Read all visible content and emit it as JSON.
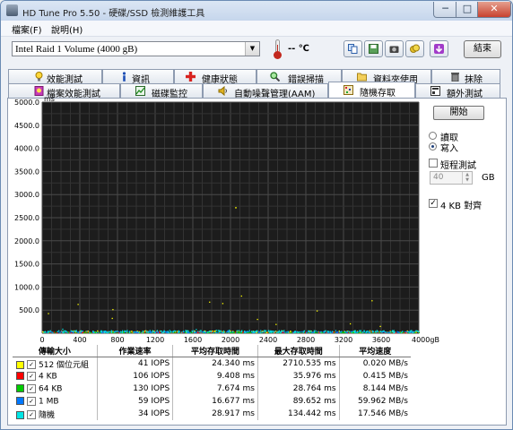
{
  "window": {
    "title": "HD Tune Pro 5.50 - 硬碟/SSD 檢測維護工具",
    "minimize": "─",
    "maximize": "□",
    "close": "✕"
  },
  "menu": {
    "file": "檔案(F)",
    "help": "說明(H)"
  },
  "toolbar": {
    "drive": "Intel  Raid 1 Volume (4000 gB)",
    "temperature": "-- ℃",
    "exit_label": "結束",
    "icons": [
      "copy-icon",
      "save-icon",
      "camera-icon",
      "coin-icon",
      "download-icon"
    ]
  },
  "tabs_row1": [
    {
      "label": "效能測試",
      "icon": "bulb-icon"
    },
    {
      "label": "資訊",
      "icon": "info-icon"
    },
    {
      "label": "健康狀態",
      "icon": "health-icon"
    },
    {
      "label": "錯誤掃描",
      "icon": "magnifier-icon"
    },
    {
      "label": "資料夾使用",
      "icon": "folder-icon"
    },
    {
      "label": "抹除",
      "icon": "trash-icon"
    }
  ],
  "tabs_row2": [
    {
      "label": "檔案效能測試",
      "icon": "file-bulb-icon"
    },
    {
      "label": "磁碟監控",
      "icon": "monitor-icon"
    },
    {
      "label": "自動噪聲管理(AAM)",
      "icon": "speaker-icon"
    },
    {
      "label": "隨機存取",
      "icon": "random-icon",
      "active": true
    },
    {
      "label": "額外測試",
      "icon": "extra-icon"
    }
  ],
  "controls": {
    "start_label": "開始",
    "read_label": "讀取",
    "write_label": "寫入",
    "mode": "write",
    "short_test_label": "短程測試",
    "short_test_checked": false,
    "size_value": "40",
    "size_unit": "GB",
    "align_label": "4 KB 對齊",
    "align_checked": true
  },
  "chart_data": {
    "type": "scatter",
    "ylabel": "ms",
    "xlabel": "gB",
    "xlim": [
      0,
      4000
    ],
    "ylim": [
      0,
      5000
    ],
    "x_ticks": [
      "0",
      "400",
      "800",
      "1200",
      "1600",
      "2000",
      "2400",
      "2800",
      "3200",
      "3600",
      "4000gB"
    ],
    "y_ticks": [
      "5000.0",
      "4500.0",
      "4000.0",
      "3500.0",
      "3000.0",
      "2500.0",
      "2000.0",
      "1500.0",
      "1000.0",
      "500.0"
    ],
    "grid": true,
    "background": "#1c1c1c",
    "series": [
      {
        "name": "512 個位元組",
        "color": "#ffff00",
        "avg_ms": 24.34,
        "max_ms": 2710.535
      },
      {
        "name": "4 KB",
        "color": "#ff0000",
        "avg_ms": 9.408,
        "max_ms": 35.976
      },
      {
        "name": "64 KB",
        "color": "#00cc00",
        "avg_ms": 7.674,
        "max_ms": 28.764
      },
      {
        "name": "1 MB",
        "color": "#0078ff",
        "avg_ms": 16.677,
        "max_ms": 89.652
      },
      {
        "name": "隨機",
        "color": "#00e5e5",
        "avg_ms": 28.917,
        "max_ms": 134.442
      }
    ]
  },
  "results": {
    "headers": [
      "傳輸大小",
      "作業速率",
      "平均存取時間",
      "最大存取時間",
      "平均速度"
    ],
    "rows": [
      {
        "color": "#ffff00",
        "size": "512 個位元組",
        "ops": "41 IOPS",
        "avg": "24.340 ms",
        "max": "2710.535 ms",
        "speed": "0.020 MB/s"
      },
      {
        "color": "#ff0000",
        "size": "4 KB",
        "ops": "106 IOPS",
        "avg": "9.408 ms",
        "max": "35.976 ms",
        "speed": "0.415 MB/s"
      },
      {
        "color": "#00cc00",
        "size": "64 KB",
        "ops": "130 IOPS",
        "avg": "7.674 ms",
        "max": "28.764 ms",
        "speed": "8.144 MB/s"
      },
      {
        "color": "#0078ff",
        "size": "1 MB",
        "ops": "59 IOPS",
        "avg": "16.677 ms",
        "max": "89.652 ms",
        "speed": "59.962 MB/s"
      },
      {
        "color": "#00e5e5",
        "size": "隨機",
        "ops": "34 IOPS",
        "avg": "28.917 ms",
        "max": "134.442 ms",
        "speed": "17.546 MB/s"
      }
    ]
  }
}
